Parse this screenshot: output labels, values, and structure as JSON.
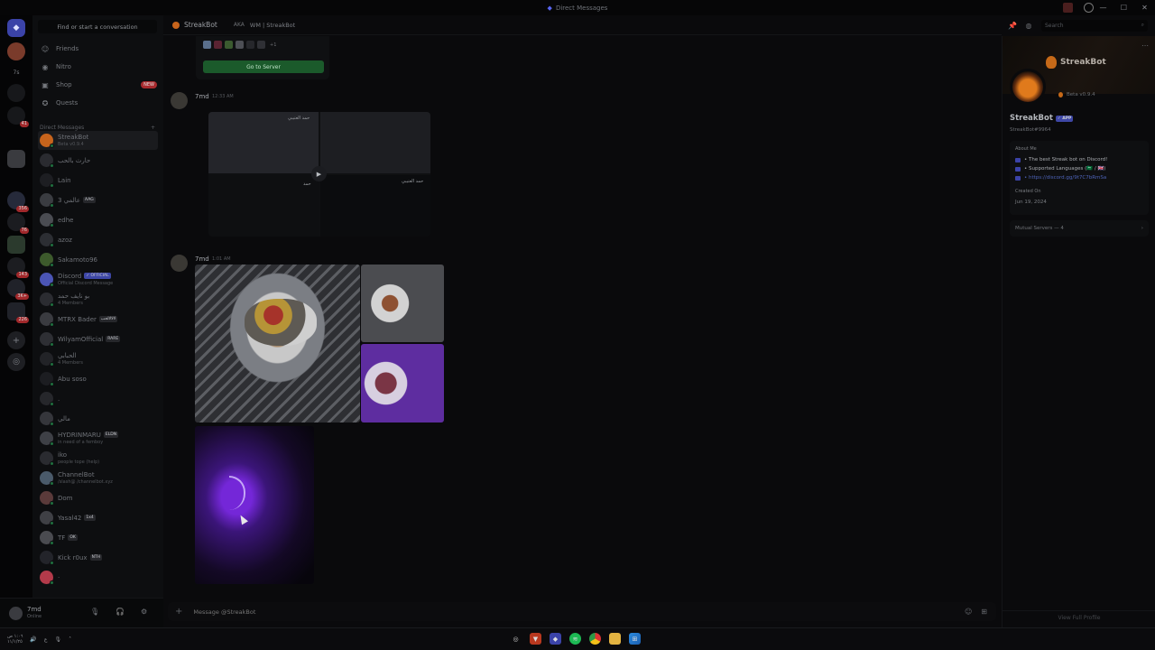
{
  "window": {
    "title": "Direct Messages",
    "controls": [
      "—",
      "☐",
      "✕"
    ]
  },
  "rail": {
    "servers": [
      {
        "label": "",
        "badge": ""
      },
      {
        "label": "",
        "badge": ""
      },
      {
        "label": "7s",
        "badge": ""
      },
      {
        "label": "",
        "badge": ""
      },
      {
        "label": "",
        "badge": "41"
      },
      {
        "label": "",
        "badge": ""
      },
      {
        "label": "",
        "badge": "356"
      },
      {
        "label": "",
        "badge": "76"
      },
      {
        "label": "",
        "badge": ""
      },
      {
        "label": "",
        "badge": "143"
      },
      {
        "label": "",
        "badge": "3K+"
      },
      {
        "label": "",
        "badge": "226"
      }
    ]
  },
  "sidebar": {
    "find_placeholder": "Find or start a conversation",
    "nav": [
      {
        "label": "Friends",
        "icon": "friends-icon"
      },
      {
        "label": "Nitro",
        "icon": "nitro-icon"
      },
      {
        "label": "Shop",
        "icon": "shop-icon",
        "badge": "NEW"
      },
      {
        "label": "Quests",
        "icon": "quests-icon"
      }
    ],
    "dm_header": "Direct Messages",
    "dm_add": "+",
    "dms": [
      {
        "name": "StreakBot",
        "sub": "Beta v0.9.4",
        "tag": "",
        "selected": true
      },
      {
        "name": "حارث بالحب",
        "sub": "",
        "tag": ""
      },
      {
        "name": "Lain",
        "sub": "",
        "tag": ""
      },
      {
        "name": "",
        "sub": "",
        "tag": "AAG",
        "prefix": "3 عالمي"
      },
      {
        "name": "edhe",
        "sub": "",
        "tag": ""
      },
      {
        "name": "azoz",
        "sub": "",
        "tag": ""
      },
      {
        "name": "Sakamoto96",
        "sub": "",
        "tag": ""
      },
      {
        "name": "Discord",
        "sub": "Official Discord Message",
        "tag": "✓ OFFICIAL",
        "tagclass": "blue"
      },
      {
        "name": "بو نايف حمد",
        "sub": "4 Members",
        "tag": ""
      },
      {
        "name": "MTRX Bader",
        "sub": "",
        "tag": "لالالالحب"
      },
      {
        "name": "WilyamOfficial",
        "sub": "",
        "tag": "RARE"
      },
      {
        "name": "الحبابي",
        "sub": "4 Members",
        "tag": ""
      },
      {
        "name": "Abu soso",
        "sub": "",
        "tag": ""
      },
      {
        "name": ".",
        "sub": "",
        "tag": ""
      },
      {
        "name": "مالي",
        "sub": "",
        "tag": ""
      },
      {
        "name": "HYDRINMARU",
        "sub": "in need of a femboy",
        "tag": "ELDN"
      },
      {
        "name": "iko",
        "sub": "people tope (help)",
        "tag": ""
      },
      {
        "name": "ChannelBot",
        "sub": "/slash@ /channelbot.xyz",
        "tag": ""
      },
      {
        "name": "Dom",
        "sub": "",
        "tag": ""
      },
      {
        "name": "Yasal42",
        "sub": "",
        "tag": "1x4"
      },
      {
        "name": "TF",
        "sub": "",
        "tag": "OK"
      },
      {
        "name": "Kick r0ux",
        "sub": "",
        "tag": "NTH"
      },
      {
        "name": "·",
        "sub": "",
        "tag": ""
      }
    ]
  },
  "user_panel": {
    "name": "7md",
    "status": "Online"
  },
  "header": {
    "name": "StreakBot",
    "aka": "AKA",
    "alias": "WM | StreakBot",
    "search_placeholder": "Search"
  },
  "chat": {
    "embed_button": "Go to Server",
    "embed_more": "+1",
    "messages": [
      {
        "author": "7md",
        "time": "12:33 AM"
      },
      {
        "author": "7md",
        "time": "1:01 AM"
      }
    ],
    "captions": [
      "حمد العتيبي",
      "حمد",
      "حمد العتيبي"
    ],
    "play_icon": "▶"
  },
  "composer": {
    "placeholder": "Message @StreakBot",
    "plus": "+"
  },
  "profile": {
    "banner_text": "StreakBot",
    "status_text": "Beta v0.9.4",
    "name": "StreakBot",
    "app_tag": "✓ APP",
    "tag": "StreakBot#9964",
    "about_header": "About Me",
    "about_lines": [
      "• The best Streak bot on Discord!",
      "• Supported Languages (🇸🇦 / 🇬🇧)",
      "• https://discord.gg/9t7C7bRmSa"
    ],
    "created_header": "Created On",
    "created_value": "Jun 19, 2024",
    "mutual": "Mutual Servers — 4",
    "view_full": "View Full Profile"
  },
  "taskbar": {
    "time": "١:٠٦ ص",
    "date": "١١/١/٢٥",
    "lang": "ع"
  },
  "colors": {
    "accent": "#5865f2",
    "green": "#1b5a2b",
    "notif": "#a1282b"
  }
}
